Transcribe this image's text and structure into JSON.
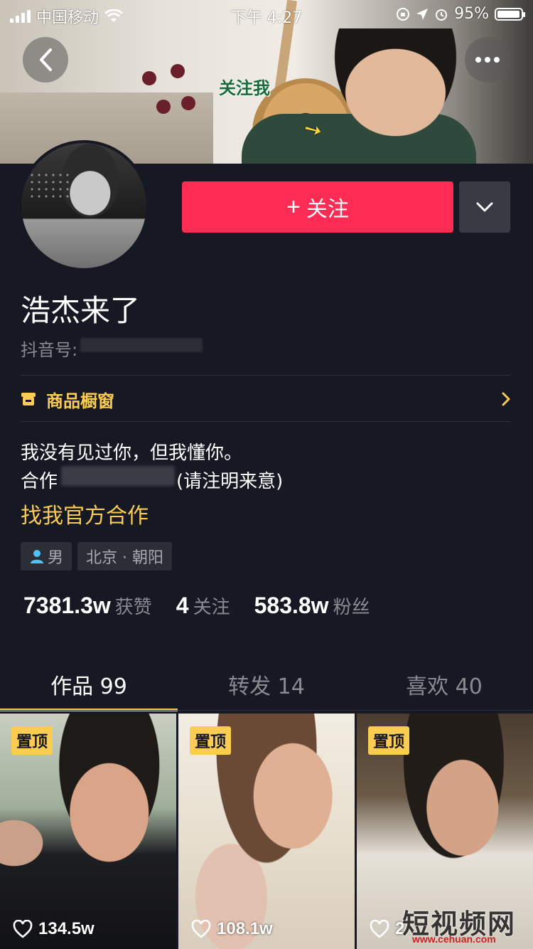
{
  "status_bar": {
    "carrier": "中国移动",
    "time": "下午 4:27",
    "battery": "95%",
    "battery_level": 0.95
  },
  "banner": {
    "overlay_text": "关注我"
  },
  "actions": {
    "follow_label": "关注",
    "follow_plus": "+"
  },
  "profile": {
    "nickname": "浩杰来了",
    "douyin_id_label": "抖音号:",
    "shop_label": "商品橱窗",
    "bio_line1": "我没有见过你，但我懂你。",
    "contact_prefix": "合作",
    "contact_suffix": "(请注明来意)",
    "official_link": "找我官方合作",
    "gender": "男",
    "location": "北京 · 朝阳"
  },
  "stats": [
    {
      "value": "7381.3w",
      "label": "获赞"
    },
    {
      "value": "4",
      "label": "关注"
    },
    {
      "value": "583.8w",
      "label": "粉丝"
    }
  ],
  "tabs": [
    {
      "label": "作品 99",
      "active": true
    },
    {
      "label": "转发 14",
      "active": false
    },
    {
      "label": "喜欢 40",
      "active": false
    }
  ],
  "videos": [
    {
      "pin": "置顶",
      "likes": "134.5w"
    },
    {
      "pin": "置顶",
      "likes": "108.1w"
    },
    {
      "pin": "置顶",
      "likes": "2"
    }
  ],
  "watermark": {
    "text": "短视频网",
    "url": "www.cehuan.com"
  },
  "colors": {
    "background": "#161823",
    "accent_red": "#fe2c55",
    "accent_yellow": "#facd52"
  }
}
